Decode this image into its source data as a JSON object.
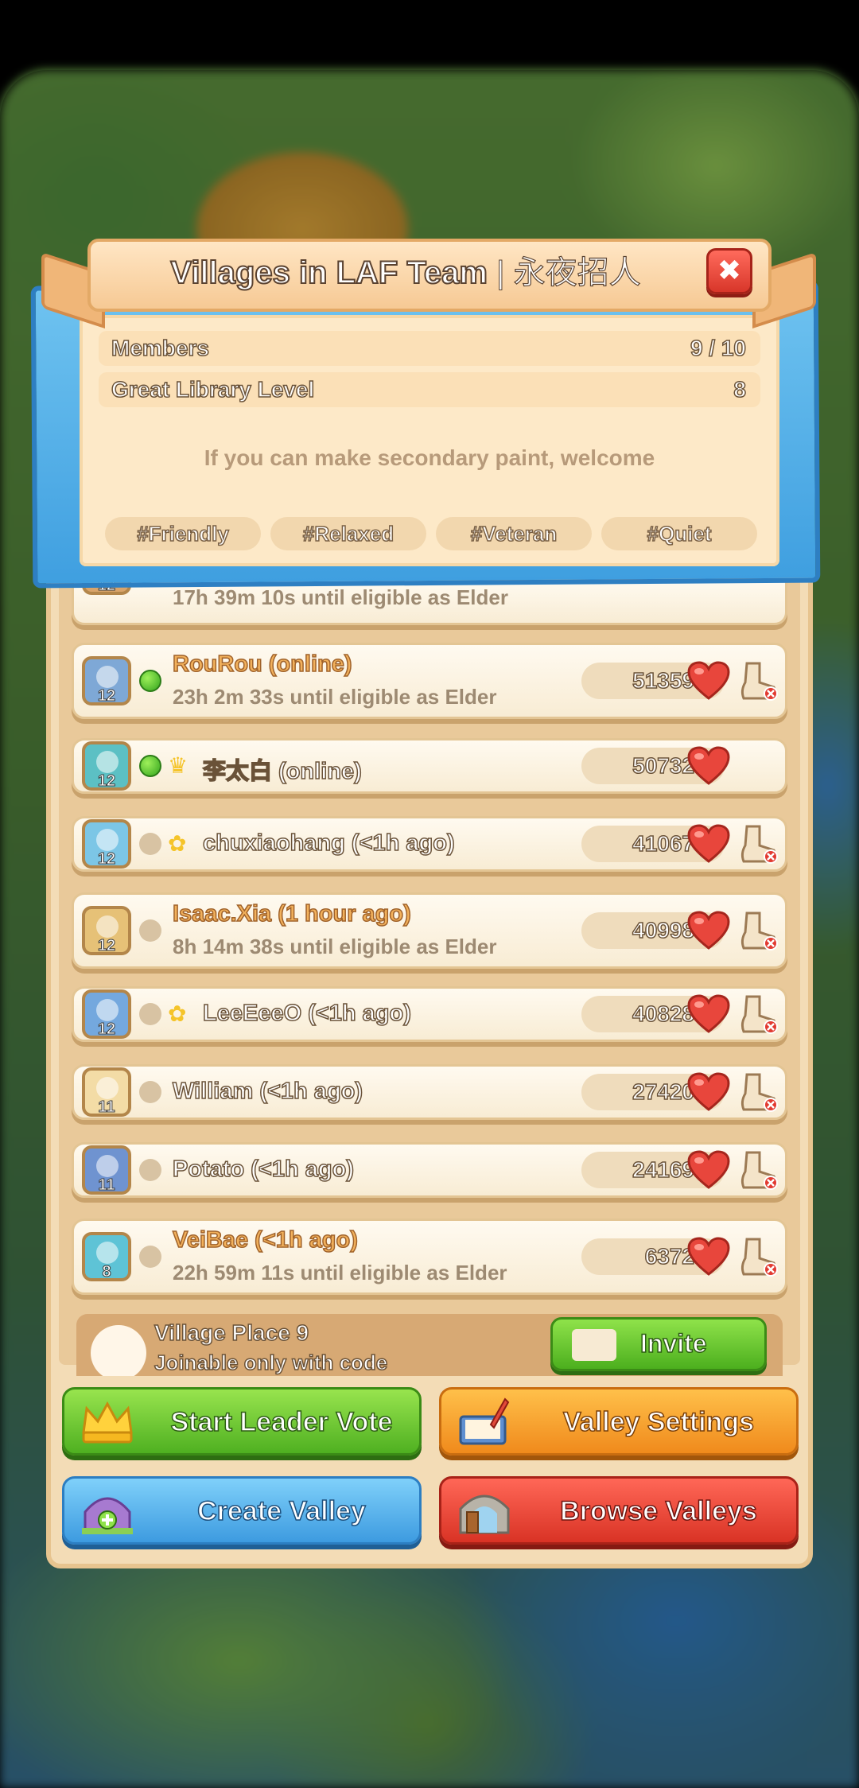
{
  "header": {
    "title": "Villages in LAF Team",
    "separator": "|",
    "subtitle": "永夜招人"
  },
  "info": {
    "members_label": "Members",
    "members_value": "9 / 10",
    "library_label": "Great Library Level",
    "library_value": "8",
    "motto": "If you can make secondary paint, welcome",
    "tags": [
      "#Friendly",
      "#Relaxed",
      "#Veteran",
      "#Quiet"
    ]
  },
  "partial_row": {
    "level": "12",
    "sub": "17h 39m 10s until eligible as Elder"
  },
  "members": [
    {
      "level": "12",
      "name": "RouRou (online)",
      "sub": "23h 2m 33s until eligible as Elder",
      "score": "51359",
      "online": true,
      "badge": "",
      "kick": true,
      "avatar_color": "#7ea8d6"
    },
    {
      "level": "12",
      "name": "李太白 (online)",
      "sub": "",
      "score": "50732",
      "online": true,
      "badge": "crown-icon",
      "kick": false,
      "avatar_color": "#5cc0c4"
    },
    {
      "level": "12",
      "name": "chuxiaohang (<1h ago)",
      "sub": "",
      "score": "41067",
      "online": false,
      "badge": "knot-icon",
      "kick": true,
      "avatar_color": "#7cc6e6"
    },
    {
      "level": "12",
      "name": "Isaac.Xia (1 hour ago)",
      "sub": "8h 14m 38s until eligible as Elder",
      "score": "40998",
      "online": false,
      "badge": "",
      "kick": true,
      "avatar_color": "#e6c177"
    },
    {
      "level": "12",
      "name": "LeeEeeO (<1h ago)",
      "sub": "",
      "score": "40828",
      "online": false,
      "badge": "knot-icon",
      "kick": true,
      "avatar_color": "#74a8de"
    },
    {
      "level": "11",
      "name": "William (<1h ago)",
      "sub": "",
      "score": "27420",
      "online": false,
      "badge": "",
      "kick": true,
      "avatar_color": "#f3dca6"
    },
    {
      "level": "11",
      "name": "Potato (<1h ago)",
      "sub": "",
      "score": "24169",
      "online": false,
      "badge": "",
      "kick": true,
      "avatar_color": "#6f93d0"
    },
    {
      "level": "8",
      "name": "VeiBae (<1h ago)",
      "sub": "22h 59m 11s until eligible as Elder",
      "score": "6372",
      "online": false,
      "badge": "",
      "kick": true,
      "avatar_color": "#5ec3d6"
    }
  ],
  "village_place": {
    "title": "Village Place 9",
    "sub": "Joinable only with code",
    "invite_label": "Invite"
  },
  "buttons": {
    "start_vote": "Start Leader Vote",
    "valley_settings": "Valley Settings",
    "create_valley": "Create Valley",
    "browse_valleys": "Browse Valleys"
  },
  "colors": {
    "online": "#33a41d",
    "panel": "#f3dcb6",
    "green_button": "#4fb021",
    "orange_button": "#f08a1c",
    "blue_button": "#3d9be0",
    "red_button": "#d93325"
  }
}
